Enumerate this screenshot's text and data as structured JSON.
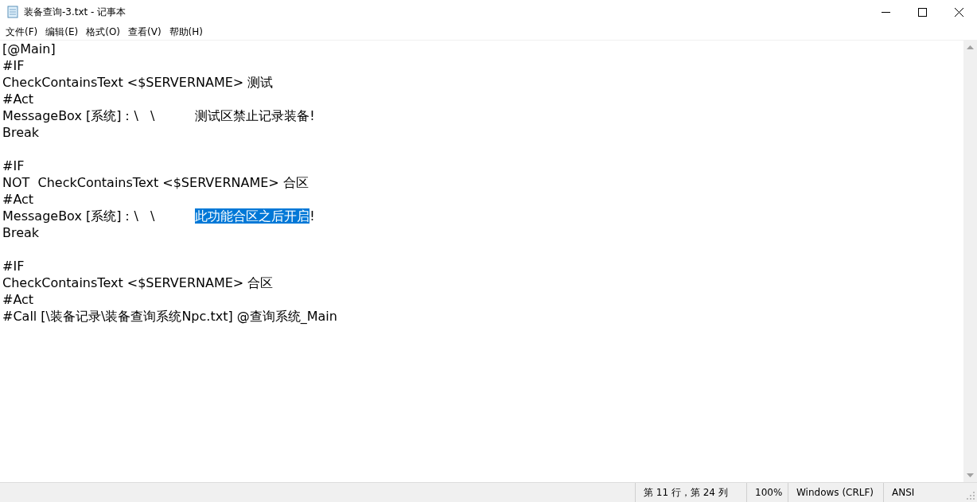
{
  "window": {
    "title": "装备查询-3.txt - 记事本"
  },
  "menu": [
    "文件(F)",
    "编辑(E)",
    "格式(O)",
    "查看(V)",
    "帮助(H)"
  ],
  "editor": {
    "lines": [
      {
        "kind": "text",
        "segments": [
          {
            "text": "[@Main]",
            "selected": false
          }
        ]
      },
      {
        "kind": "text",
        "segments": [
          {
            "text": "#IF",
            "selected": false
          }
        ]
      },
      {
        "kind": "text",
        "segments": [
          {
            "text": "CheckContainsText <$SERVERNAME> 测试",
            "selected": false
          }
        ]
      },
      {
        "kind": "text",
        "segments": [
          {
            "text": "#Act",
            "selected": false
          }
        ]
      },
      {
        "kind": "text",
        "segments": [
          {
            "text": "MessageBox [系统]：\\   \\          测试区禁止记录装备!",
            "selected": false
          }
        ]
      },
      {
        "kind": "text",
        "segments": [
          {
            "text": "Break",
            "selected": false
          }
        ]
      },
      {
        "kind": "blank"
      },
      {
        "kind": "text",
        "segments": [
          {
            "text": "#IF",
            "selected": false
          }
        ]
      },
      {
        "kind": "text",
        "segments": [
          {
            "text": "NOT  CheckContainsText <$SERVERNAME> 合区",
            "selected": false
          }
        ]
      },
      {
        "kind": "text",
        "segments": [
          {
            "text": "#Act",
            "selected": false
          }
        ]
      },
      {
        "kind": "text",
        "segments": [
          {
            "text": "MessageBox [系统]：\\   \\          ",
            "selected": false
          },
          {
            "text": "此功能合区之后开启",
            "selected": true
          },
          {
            "text": "!",
            "selected": false
          }
        ]
      },
      {
        "kind": "text",
        "segments": [
          {
            "text": "Break",
            "selected": false
          }
        ]
      },
      {
        "kind": "blank"
      },
      {
        "kind": "text",
        "segments": [
          {
            "text": "#IF",
            "selected": false
          }
        ]
      },
      {
        "kind": "text",
        "segments": [
          {
            "text": "CheckContainsText <$SERVERNAME> 合区",
            "selected": false
          }
        ]
      },
      {
        "kind": "text",
        "segments": [
          {
            "text": "#Act",
            "selected": false
          }
        ]
      },
      {
        "kind": "text",
        "segments": [
          {
            "text": "#Call [\\装备记录\\装备查询系统Npc.txt] @查询系统_Main",
            "selected": false
          }
        ]
      }
    ]
  },
  "status_bar": {
    "position": "第 11 行，第 24 列",
    "zoom": "100%",
    "line_ending": "Windows (CRLF)",
    "encoding": "ANSI"
  }
}
